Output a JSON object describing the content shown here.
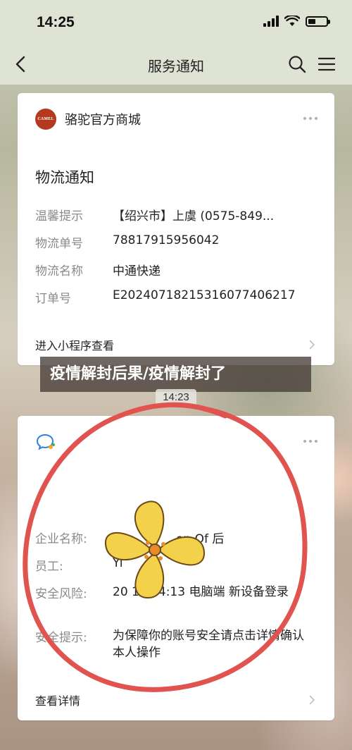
{
  "status_bar": {
    "time": "14:25"
  },
  "nav": {
    "title": "服务通知"
  },
  "card1": {
    "shop_name": "骆驼官方商城",
    "avatar_text": "CAMEL",
    "title": "物流通知",
    "fields": [
      {
        "label": "温馨提示",
        "value": "【绍兴市】上虞 (0575-849..."
      },
      {
        "label": "物流单号",
        "value": "78817915956042"
      },
      {
        "label": "物流名称",
        "value": "中通快递"
      },
      {
        "label": "订单号",
        "value": "E20240718215316077406217"
      }
    ],
    "footer": "进入小程序查看"
  },
  "overlay": {
    "caption": "疫情解封后果/疫情解封了"
  },
  "timestamp": "14:23",
  "card2": {
    "fields": [
      {
        "label": "企业名称:",
        "value": "on Of 后"
      },
      {
        "label": "员工:",
        "value": "Yi"
      },
      {
        "label": "安全风险:",
        "value": "20  19 14:13 电脑端 新设备登录"
      },
      {
        "label": "安全提示:",
        "value": "为保障你的账号安全请点击详情确认本人操作"
      }
    ],
    "footer": "查看详情"
  },
  "icons": {
    "back": "chevron-left-icon",
    "search": "search-icon",
    "menu": "menu-icon",
    "wechat_work": "wechat-work-icon"
  },
  "colors": {
    "accent_red": "#e0534f",
    "flower_yellow": "#f3d14b",
    "nav_bg": "#dfe3d3"
  }
}
